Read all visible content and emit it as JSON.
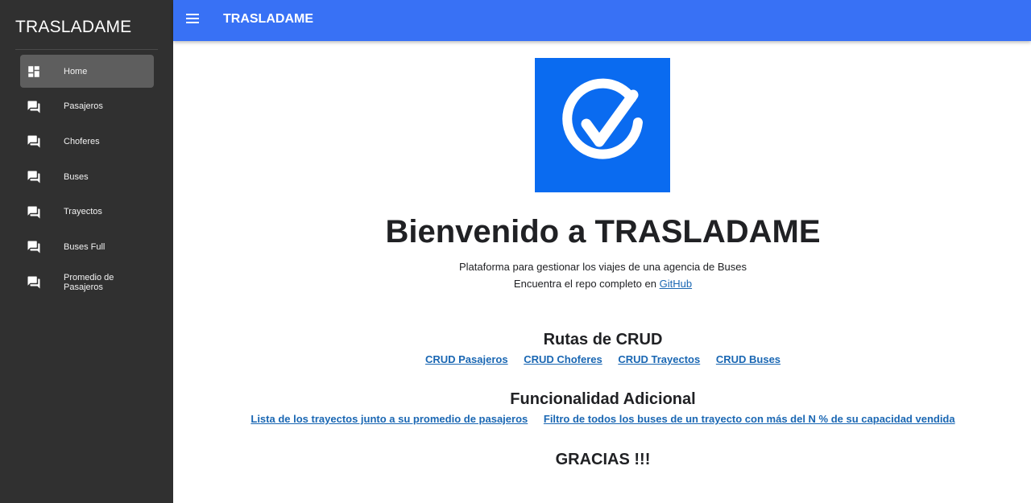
{
  "sidebar": {
    "brand": "TRASLADAME",
    "items": [
      {
        "label": "Home",
        "icon": "dashboard-icon",
        "active": true
      },
      {
        "label": "Pasajeros",
        "icon": "forum-icon"
      },
      {
        "label": "Choferes",
        "icon": "forum-icon"
      },
      {
        "label": "Buses",
        "icon": "forum-icon"
      },
      {
        "label": "Trayectos",
        "icon": "forum-icon"
      },
      {
        "label": "Buses Full",
        "icon": "forum-icon"
      },
      {
        "label": "Promedio de Pasajeros",
        "icon": "forum-icon"
      }
    ]
  },
  "topbar": {
    "menu_icon": "menu-icon",
    "title": "TRASLADAME"
  },
  "main": {
    "logo_icon": "check-circle-icon",
    "welcome": "Bienvenido a TRASLADAME",
    "subtitle": "Plataforma para gestionar los viajes de una agencia de Buses",
    "repo_text": "Encuentra el repo completo en",
    "repo_link": "GitHub",
    "crud": {
      "title": "Rutas de CRUD",
      "links": [
        "CRUD Pasajeros",
        "CRUD Choferes",
        "CRUD Trayectos",
        "CRUD Buses"
      ]
    },
    "extra": {
      "title": "Funcionalidad Adicional",
      "links": [
        "Lista de los trayectos junto a su promedio de pasajeros",
        "Filtro de todos los buses de un trayecto con más del N % de su capacidad vendida"
      ]
    },
    "thanks": "GRACIAS !!!"
  },
  "colors": {
    "sidebar_bg": "#303030",
    "topbar_bg": "#3871f5",
    "logo_bg": "#0a6bf0",
    "link": "#1a67b3"
  }
}
